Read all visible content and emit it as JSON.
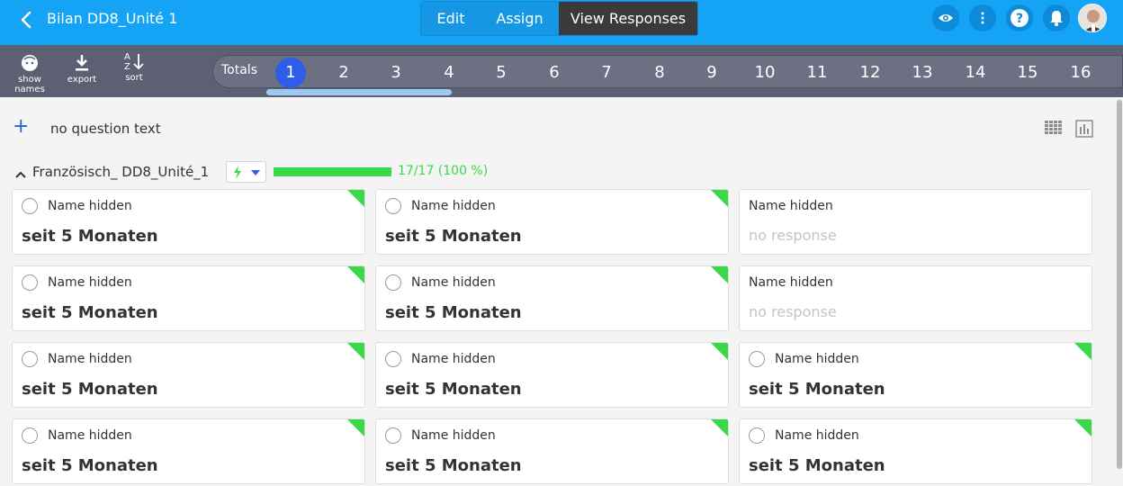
{
  "header": {
    "title": "Bilan DD8_Unité 1",
    "tabs": [
      {
        "label": "Edit"
      },
      {
        "label": "Assign"
      },
      {
        "label": "View Responses"
      }
    ],
    "icons": [
      "eye-icon",
      "more-vertical-icon",
      "help-icon",
      "bell-icon"
    ]
  },
  "toolbar": {
    "show_names": "show names",
    "export": "export",
    "sort": "sort",
    "sort_glyph_a": "A",
    "sort_glyph_z": "Z",
    "totals": "Totals",
    "questions": [
      "1",
      "2",
      "3",
      "4",
      "5",
      "6",
      "7",
      "8",
      "9",
      "10",
      "11",
      "12",
      "13",
      "14",
      "15",
      "16"
    ],
    "selected_question": "1"
  },
  "question": {
    "add": "+",
    "text": "no question text"
  },
  "group": {
    "name": "Französisch_ DD8_Unité_1",
    "progress_fraction": 1.0,
    "progress_text": "17/17 (100 %)",
    "progress_color": "#3ad94a"
  },
  "responses": [
    {
      "name": "Name hidden",
      "response": "seit 5 Monaten",
      "auto": true
    },
    {
      "name": "Name hidden",
      "response": "seit 5 Monaten",
      "auto": true
    },
    {
      "name": "Name hidden",
      "response": "no response",
      "auto": false
    },
    {
      "name": "Name hidden",
      "response": "seit 5 Monaten",
      "auto": true
    },
    {
      "name": "Name hidden",
      "response": "seit 5 Monaten",
      "auto": true
    },
    {
      "name": "Name hidden",
      "response": "no response",
      "auto": false
    },
    {
      "name": "Name hidden",
      "response": "seit 5 Monaten",
      "auto": true
    },
    {
      "name": "Name hidden",
      "response": "seit 5 Monaten",
      "auto": true
    },
    {
      "name": "Name hidden",
      "response": "seit 5 Monaten",
      "auto": true
    },
    {
      "name": "Name hidden",
      "response": "seit 5 Monaten",
      "auto": true
    },
    {
      "name": "Name hidden",
      "response": "seit 5 Monaten",
      "auto": true
    },
    {
      "name": "Name hidden",
      "response": "seit 5 Monaten",
      "auto": true
    }
  ],
  "colors": {
    "header_bg": "#14a3f5",
    "toolbar_bg": "#5d6073",
    "selected_question": "#2f5ce8",
    "accent_green": "#3ad94a"
  }
}
